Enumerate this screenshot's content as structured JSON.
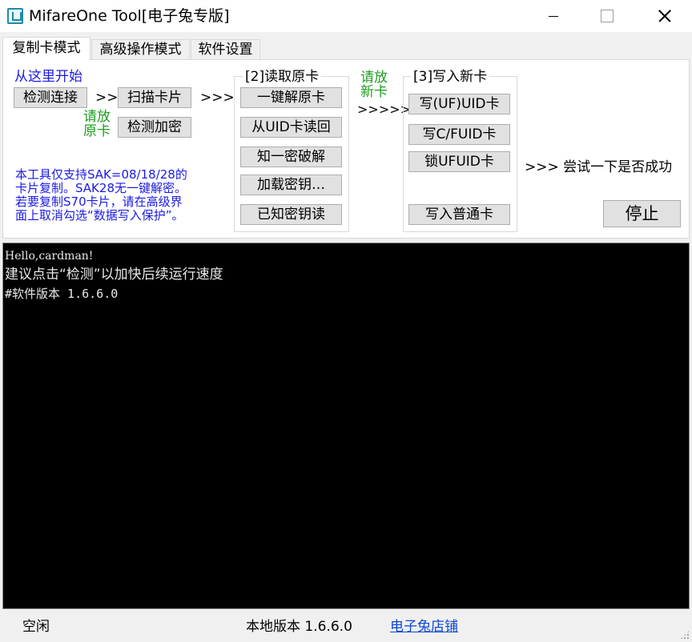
{
  "window": {
    "title": "MifareOne Tool[电子兔专版]"
  },
  "tabs": [
    {
      "label": "复制卡模式",
      "active": true
    },
    {
      "label": "高级操作模式",
      "active": false
    },
    {
      "label": "软件设置",
      "active": false
    }
  ],
  "start": {
    "heading": "从这里开始",
    "detect_button": "检测连接",
    "arrow1": ">>",
    "scan_button": "扫描卡片",
    "arrow2": ">>>",
    "place_original_line1": "请放",
    "place_original_line2": "原卡",
    "detect_encryption_button": "检测加密"
  },
  "notice": {
    "line1": "本工具仅支持SAK=08/18/28的",
    "line2": "卡片复制。SAK28无一键解密。",
    "line3": "若要复制S70卡片，请在高级界",
    "line4": "面上取消勾选“数据写入保护”。"
  },
  "read_group": {
    "title": "[2]读取原卡",
    "buttons": [
      "一键解原卡",
      "从UID卡读回",
      "知一密破解",
      "加载密钥…",
      "已知密钥读"
    ]
  },
  "middle": {
    "place_new_line1": "请放",
    "place_new_line2": "新卡",
    "arrow": ">>>>>"
  },
  "write_group": {
    "title": "[3]写入新卡",
    "buttons": [
      "写(UF)UID卡",
      "写C/FUID卡",
      "锁UFUID卡",
      "写入普通卡"
    ]
  },
  "try_hint": ">>> 尝试一下是否成功",
  "stop_button": "停止",
  "console": {
    "lines": [
      "Hello,cardman!",
      "建议点击“检测”以加快后续运行速度",
      "#软件版本 1.6.6.0"
    ]
  },
  "statusbar": {
    "status": "空闲",
    "version": "本地版本 1.6.6.0",
    "store_link": "电子兔店铺"
  },
  "colors": {
    "hint_blue": "#1a1ae6",
    "hint_green": "#1e9d1e",
    "link": "#0b45d6",
    "console_bg": "#000000"
  }
}
